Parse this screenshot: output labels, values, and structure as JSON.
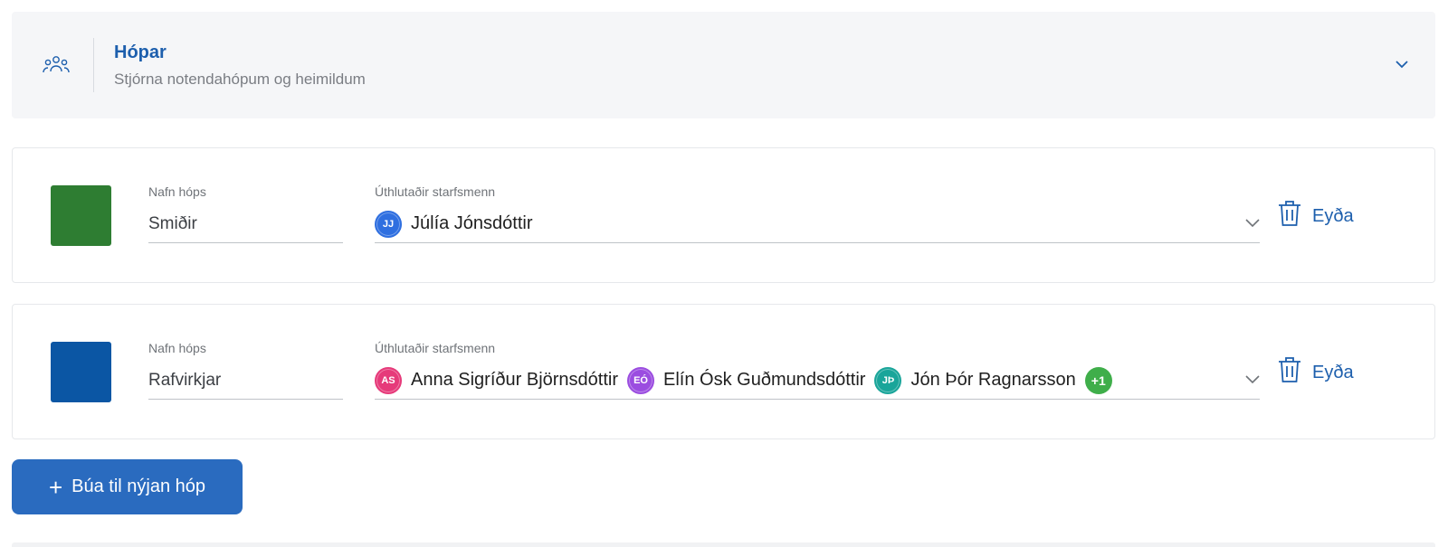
{
  "section": {
    "title": "Hópar",
    "subtitle": "Stjórna notendahópum og heimildum",
    "icon": "users-icon"
  },
  "labels": {
    "group_name": "Nafn hóps",
    "assigned_staff": "Úthlutaðir starfsmenn",
    "delete": "Eyða"
  },
  "groups": [
    {
      "name": "Smiðir",
      "color": "#2e7d32",
      "staff": [
        {
          "initials": "JJ",
          "name": "Júlía Jónsdóttir",
          "color": "#2f6fe0"
        }
      ]
    },
    {
      "name": "Rafvirkjar",
      "color": "#0b56a4",
      "staff": [
        {
          "initials": "AS",
          "name": "Anna Sigríður Björnsdóttir",
          "color": "#e63a7a"
        },
        {
          "initials": "EÓ",
          "name": "Elín Ósk Guðmundsdóttir",
          "color": "#9b4de0"
        },
        {
          "initials": "JÞ",
          "name": "Jón Þór Ragnarsson",
          "color": "#1aa59a"
        }
      ],
      "more": "+1"
    }
  ],
  "create_button": {
    "label": "Búa til nýjan hóp"
  },
  "colors": {
    "accent": "#1d5fad",
    "button": "#2a6bbf"
  }
}
